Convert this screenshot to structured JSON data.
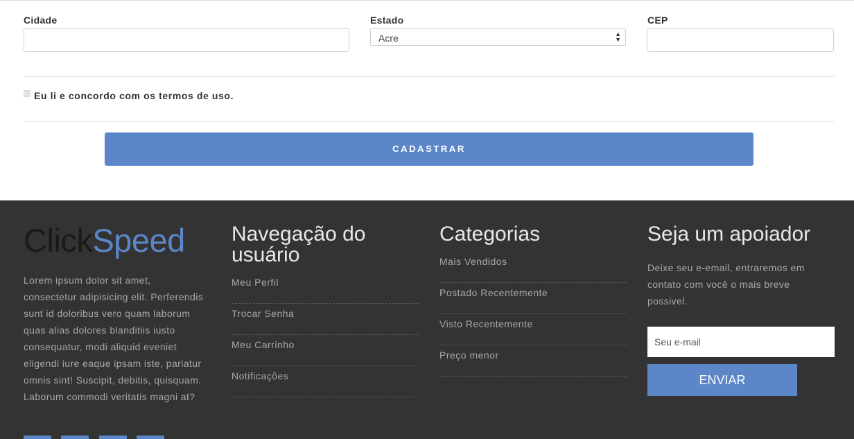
{
  "form": {
    "city_label": "Cidade",
    "city_value": "",
    "state_label": "Estado",
    "state_selected": "Acre",
    "cep_label": "CEP",
    "cep_value": "",
    "terms_checked": false,
    "terms_label": "Eu li e concordo com os termos de uso.",
    "submit_label": "CADASTRAR"
  },
  "footer": {
    "logo_part1": "Click",
    "logo_part2": "Speed",
    "about_text": "Lorem ipsum dolor sit amet, consectetur adipisicing elit. Perferendis sunt id doloribus vero quam laborum quas alias dolores blanditiis iusto consequatur, modi aliquid eveniet eligendi iure eaque ipsam iste, pariatur omnis sint! Suscipit, debitis, quisquam. Laborum commodi veritatis magni at?",
    "nav": {
      "title": "Navegação do usuário",
      "items": [
        "Meu Perfil",
        "Trocar Senha",
        "Meu Carrinho",
        "Notificações"
      ]
    },
    "categories": {
      "title": "Categorias",
      "items": [
        "Mais Vendidos",
        "Postado Recentemente",
        "Visto Recentemente",
        "Preço menor"
      ]
    },
    "support": {
      "title": "Seja um apoiador",
      "text": "Deixe seu e-email, entraremos em contato com você o mais breve possivel.",
      "email_placeholder": "Seu e-mail",
      "button_label": "ENVIAR"
    }
  },
  "colors": {
    "accent": "#5b87c9",
    "footer_bg": "#333333",
    "footer_text": "#a8a8a8"
  }
}
